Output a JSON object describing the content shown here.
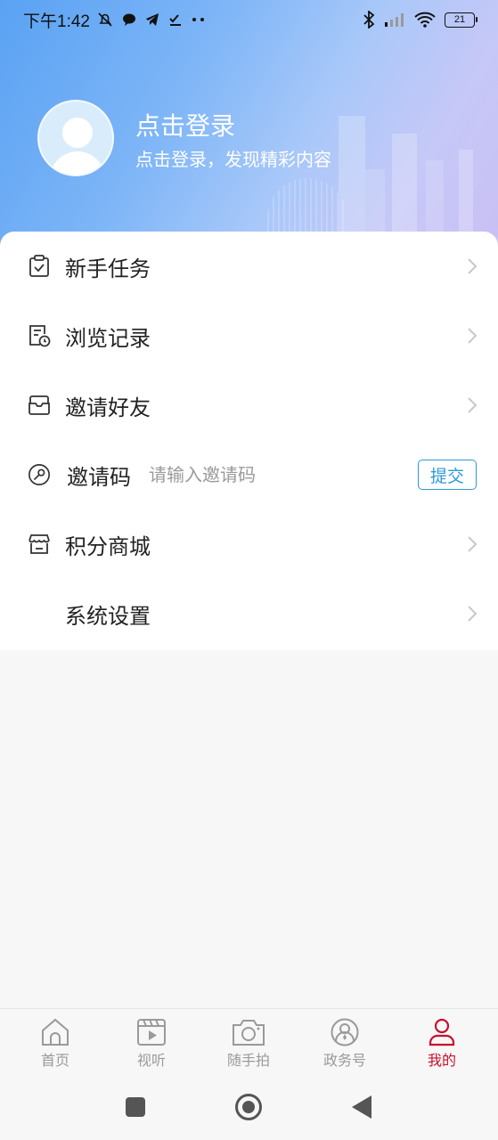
{
  "status_bar": {
    "time": "下午1:42",
    "battery": "21"
  },
  "profile": {
    "title": "点击登录",
    "subtitle": "点击登录，发现精彩内容"
  },
  "menu": {
    "items": [
      {
        "label": "新手任务",
        "icon": "clipboard-check-icon"
      },
      {
        "label": "浏览记录",
        "icon": "history-doc-icon"
      },
      {
        "label": "邀请好友",
        "icon": "envelope-icon"
      },
      {
        "label": "邀请码",
        "icon": "key-circle-icon"
      },
      {
        "label": "积分商城",
        "icon": "store-icon"
      },
      {
        "label": "系统设置",
        "icon": ""
      }
    ],
    "invite_placeholder": "请输入邀请码",
    "submit_label": "提交"
  },
  "tabs": [
    {
      "label": "首页",
      "icon": "home-icon"
    },
    {
      "label": "视听",
      "icon": "video-icon"
    },
    {
      "label": "随手拍",
      "icon": "camera-icon"
    },
    {
      "label": "政务号",
      "icon": "gov-account-icon"
    },
    {
      "label": "我的",
      "icon": "profile-icon",
      "active": true
    }
  ],
  "colors": {
    "accent_red": "#c8102e",
    "submit_blue": "#2c9ad6",
    "header_start": "#5aa2f3",
    "header_end": "#c9bff4"
  }
}
